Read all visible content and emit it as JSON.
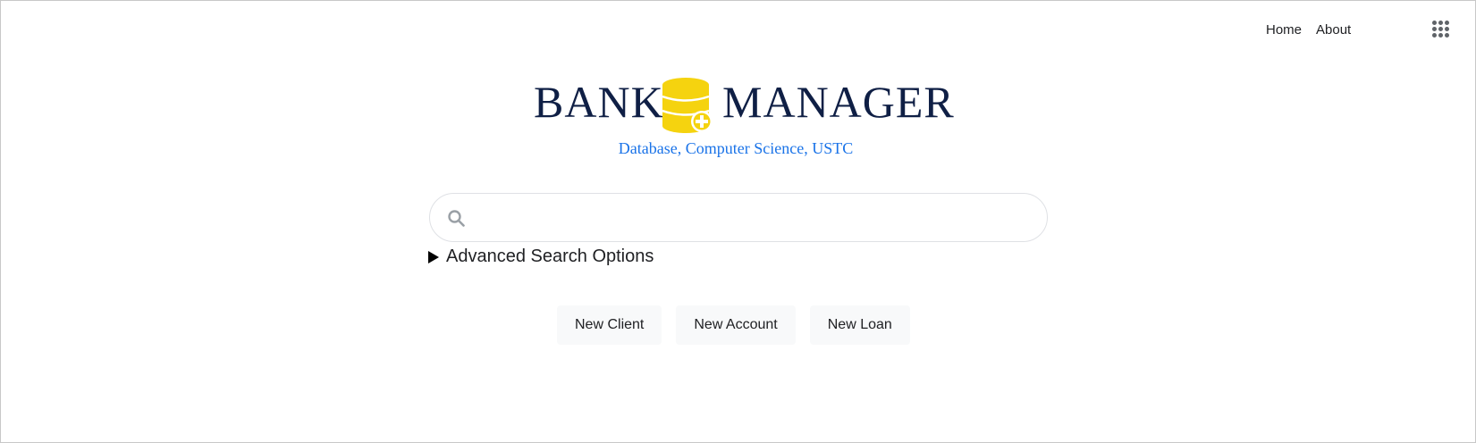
{
  "nav": {
    "home_label": "Home",
    "about_label": "About",
    "apps_icon": "apps-grid-icon"
  },
  "logo": {
    "word_left": "BANK",
    "word_right": "MANAGER",
    "subtitle": "Database, Computer Science, USTC",
    "icon": "database-plus-icon",
    "colors": {
      "text": "#0f1f45",
      "icon": "#f5d30f",
      "subtitle": "#1a73e8"
    }
  },
  "search": {
    "icon": "search-icon",
    "value": "",
    "placeholder": ""
  },
  "advanced": {
    "label": "Advanced Search Options",
    "icon": "disclosure-triangle-icon"
  },
  "actions": {
    "new_client": "New Client",
    "new_account": "New Account",
    "new_loan": "New Loan"
  }
}
